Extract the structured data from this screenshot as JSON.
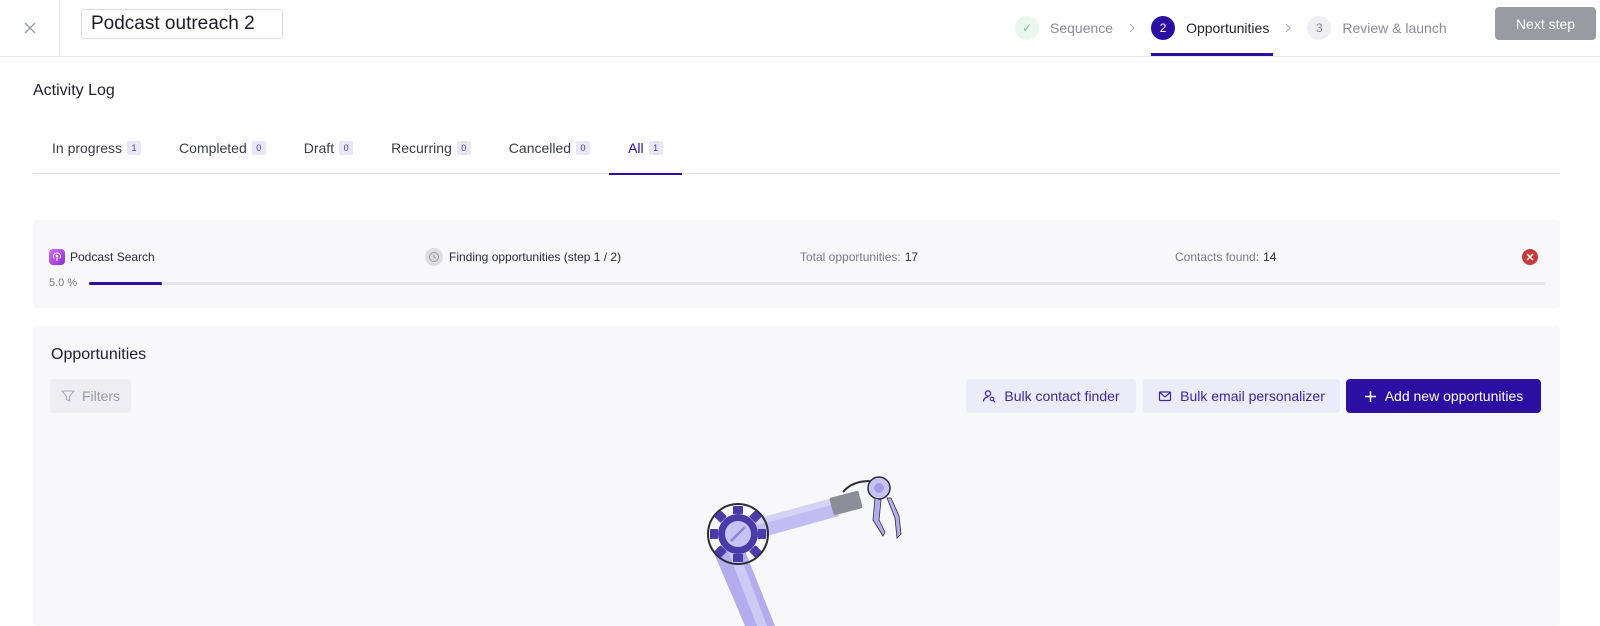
{
  "header": {
    "title_value": "Podcast outreach 2",
    "steps": [
      {
        "num": "✓",
        "label": "Sequence"
      },
      {
        "num": "2",
        "label": "Opportunities"
      },
      {
        "num": "3",
        "label": "Review & launch"
      }
    ],
    "next_label": "Next step"
  },
  "page": {
    "title": "Activity Log"
  },
  "tabs": [
    {
      "label": "In progress",
      "count": "1"
    },
    {
      "label": "Completed",
      "count": "0"
    },
    {
      "label": "Draft",
      "count": "0"
    },
    {
      "label": "Recurring",
      "count": "0"
    },
    {
      "label": "Cancelled",
      "count": "0"
    },
    {
      "label": "All",
      "count": "1"
    }
  ],
  "activity": {
    "source": "Podcast Search",
    "status": "Finding opportunities (step 1 / 2)",
    "total_label": "Total opportunities:",
    "total_value": "17",
    "contacts_label": "Contacts found:",
    "contacts_value": "14",
    "percent_text": "5.0 %",
    "progress": 0.05
  },
  "opportunities": {
    "title": "Opportunities",
    "filters_label": "Filters",
    "bulk_contact_label": "Bulk contact finder",
    "bulk_email_label": "Bulk email personalizer",
    "add_label": "Add new opportunities"
  },
  "colors": {
    "primary": "#2b0fa3",
    "danger": "#c83a3a",
    "success": "#7bc98a"
  },
  "icons": [
    "close-icon",
    "check-icon",
    "chevron-right-icon",
    "podcast-icon",
    "clock-icon",
    "cancel-icon",
    "filter-icon",
    "user-search-icon",
    "mail-icon",
    "plus-icon"
  ]
}
